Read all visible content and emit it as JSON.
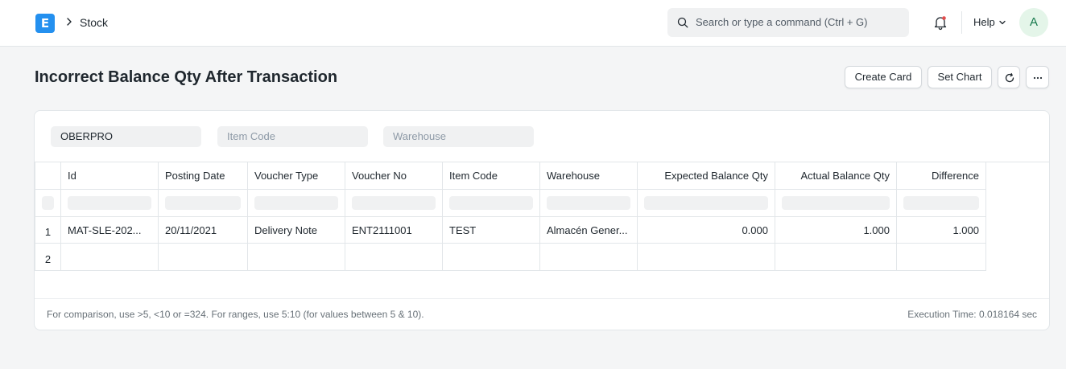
{
  "navbar": {
    "logo_letter": "E",
    "breadcrumb": "Stock",
    "search_placeholder": "Search or type a command (Ctrl + G)",
    "help_label": "Help",
    "avatar_initial": "A"
  },
  "page": {
    "title": "Incorrect Balance Qty After Transaction",
    "buttons": {
      "create_card": "Create Card",
      "set_chart": "Set Chart"
    }
  },
  "filters": {
    "company": "OBERPRO",
    "item_code_placeholder": "Item Code",
    "warehouse_placeholder": "Warehouse"
  },
  "table": {
    "columns": [
      "Id",
      "Posting Date",
      "Voucher Type",
      "Voucher No",
      "Item Code",
      "Warehouse",
      "Expected Balance Qty",
      "Actual Balance Qty",
      "Difference"
    ],
    "rows": [
      {
        "n": "1",
        "cells": [
          "MAT-SLE-202...",
          "20/11/2021",
          "Delivery Note",
          "ENT2111001",
          "TEST",
          "Almacén Gener...",
          "0.000",
          "1.000",
          "1.000"
        ]
      },
      {
        "n": "2",
        "cells": [
          "",
          "",
          "",
          "",
          "",
          "",
          "",
          "",
          ""
        ]
      }
    ]
  },
  "footer": {
    "hint": "For comparison, use >5, <10 or =324. For ranges, use 5:10 (for values between 5 & 10).",
    "execution_time": "Execution Time: 0.018164 sec"
  },
  "colors": {
    "accent": "#2490ef",
    "avatar_bg": "#e4f5e9",
    "avatar_fg": "#16794c",
    "notification_dot": "#e24c4c"
  }
}
